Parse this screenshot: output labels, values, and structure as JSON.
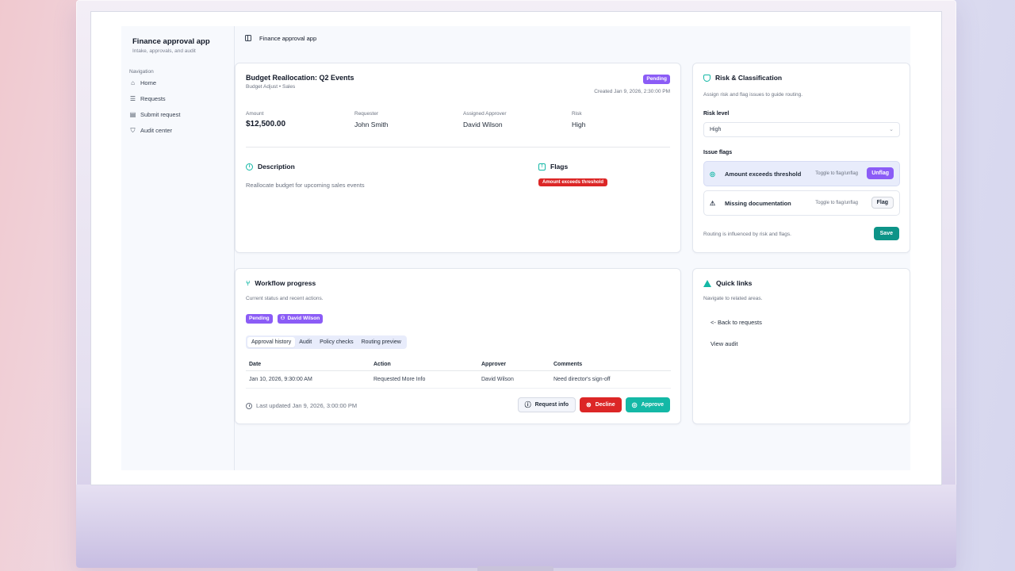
{
  "sidebar": {
    "app_title": "Finance approval app",
    "app_subtitle": "Intake, approvals, and audit",
    "nav_heading": "Navigation",
    "items": [
      {
        "label": "Home",
        "icon": "home-icon"
      },
      {
        "label": "Requests",
        "icon": "list-icon"
      },
      {
        "label": "Submit request",
        "icon": "document-icon"
      },
      {
        "label": "Audit center",
        "icon": "shield-icon"
      }
    ]
  },
  "topbar": {
    "title": "Finance approval app"
  },
  "request": {
    "title": "Budget Reallocation: Q2 Events",
    "subtitle": "Budget Adjust • Sales",
    "status": "Pending",
    "created": "Created Jan 9, 2026, 2:30:00 PM",
    "fields": {
      "amount_label": "Amount",
      "amount": "$12,500.00",
      "requester_label": "Requester",
      "requester": "John Smith",
      "approver_label": "Assigned Approver",
      "approver": "David Wilson",
      "risk_label": "Risk",
      "risk": "High"
    },
    "description_heading": "Description",
    "description": "Reallocate budget for upcoming sales events",
    "flags_heading": "Flags",
    "flags": [
      "Amount exceeds threshold"
    ]
  },
  "risk_panel": {
    "title": "Risk & Classification",
    "subtitle": "Assign risk and flag issues to guide routing.",
    "risk_level_label": "Risk level",
    "risk_level_value": "High",
    "issue_flags_label": "Issue flags",
    "flags": [
      {
        "label": "Amount exceeds threshold",
        "hint": "Toggle to flag/unflag",
        "button": "Unflag"
      },
      {
        "label": "Missing documentation",
        "hint": "Toggle to flag/unflag",
        "button": "Flag"
      }
    ],
    "routing_note": "Routing is influenced by risk and flags.",
    "save_label": "Save"
  },
  "workflow": {
    "title": "Workflow progress",
    "subtitle": "Current status and recent actions.",
    "status_badge": "Pending",
    "approver_badge": "David Wilson",
    "tabs": [
      "Approval history",
      "Audit",
      "Policy checks",
      "Routing preview"
    ],
    "columns": [
      "Date",
      "Action",
      "Approver",
      "Comments"
    ],
    "rows": [
      [
        "Jan 10, 2026, 9:30:00 AM",
        "Requested More Info",
        "David Wilson",
        "Need director's sign-off"
      ]
    ],
    "last_updated": "Last updated Jan 9, 2026, 3:00:00 PM",
    "actions": {
      "info": "Request info",
      "decline": "Decline",
      "approve": "Approve"
    }
  },
  "quick_links": {
    "title": "Quick links",
    "subtitle": "Navigate to related areas.",
    "links": [
      "<- Back to requests",
      "View audit"
    ]
  },
  "colors": {
    "accent_purple": "#8b5cf6",
    "teal": "#14b8a6",
    "danger": "#dc2626"
  }
}
